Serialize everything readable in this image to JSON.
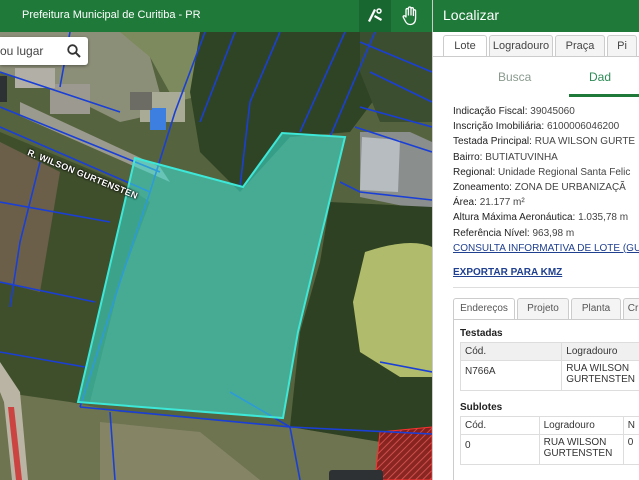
{
  "header": {
    "title": "Prefeitura Municipal de Curitiba - PR",
    "tools": [
      {
        "name": "measure",
        "icon": "measure-tool-icon"
      },
      {
        "name": "pan",
        "icon": "hand-pan-icon"
      }
    ]
  },
  "map": {
    "search_placeholder": "ou lugar",
    "street_label": "R. WILSON GURTENSTEN"
  },
  "panel": {
    "title": "Localizar",
    "tabs": [
      {
        "label": "Lote",
        "active": true
      },
      {
        "label": "Logradouro",
        "active": false
      },
      {
        "label": "Praça",
        "active": false
      },
      {
        "label": "Pi",
        "active": false
      }
    ],
    "subtabs": [
      {
        "label": "Busca",
        "active": false
      },
      {
        "label": "Dad",
        "active": true
      }
    ],
    "fields": [
      {
        "label": "Indicação Fiscal:",
        "value": "39045060"
      },
      {
        "label": "Inscrição Imobiliária:",
        "value": "6100006046200"
      },
      {
        "label": "Testada Principal:",
        "value": "RUA WILSON GURTE"
      },
      {
        "label": "Bairro:",
        "value": "BUTIATUVINHA"
      },
      {
        "label": "Regional:",
        "value": "Unidade Regional Santa Felic"
      },
      {
        "label": "Zoneamento:",
        "value": "ZONA DE URBANIZAÇÃ"
      },
      {
        "label": "Área:",
        "value": "21.177 m²"
      },
      {
        "label": "Altura Máxima Aeronáutica:",
        "value": "1.035,78 m"
      },
      {
        "label": "Referência Nível:",
        "value": "963,98 m"
      }
    ],
    "consulta_link": "CONSULTA INFORMATIVA DE LOTE (GU",
    "export_link": "EXPORTAR PARA KMZ",
    "bottom_tabs": [
      {
        "label": "Endereços",
        "active": true
      },
      {
        "label": "Projeto",
        "active": false
      },
      {
        "label": "Planta",
        "active": false
      },
      {
        "label": "Cr",
        "active": false
      }
    ],
    "testadas": {
      "title": "Testadas",
      "columns": [
        "Cód.",
        "Logradouro"
      ],
      "rows": [
        {
          "cod": "N766A",
          "logradouro_1": "RUA WILSON",
          "logradouro_2": "GURTENSTEN"
        }
      ]
    },
    "sublotes": {
      "title": "Sublotes",
      "columns": [
        "Cód.",
        "Logradouro",
        "N"
      ],
      "rows": [
        {
          "cod": "0",
          "logradouro_1": "RUA WILSON",
          "logradouro_2": "GURTENSTEN",
          "n": "0"
        }
      ]
    }
  },
  "colors": {
    "header_green": "#1f7a3a",
    "parcel_outline": "#3de8d8",
    "lot_lines": "#1a3fd6",
    "link_blue": "#1f3f8f",
    "zone_yellow": "#e8f08a"
  }
}
